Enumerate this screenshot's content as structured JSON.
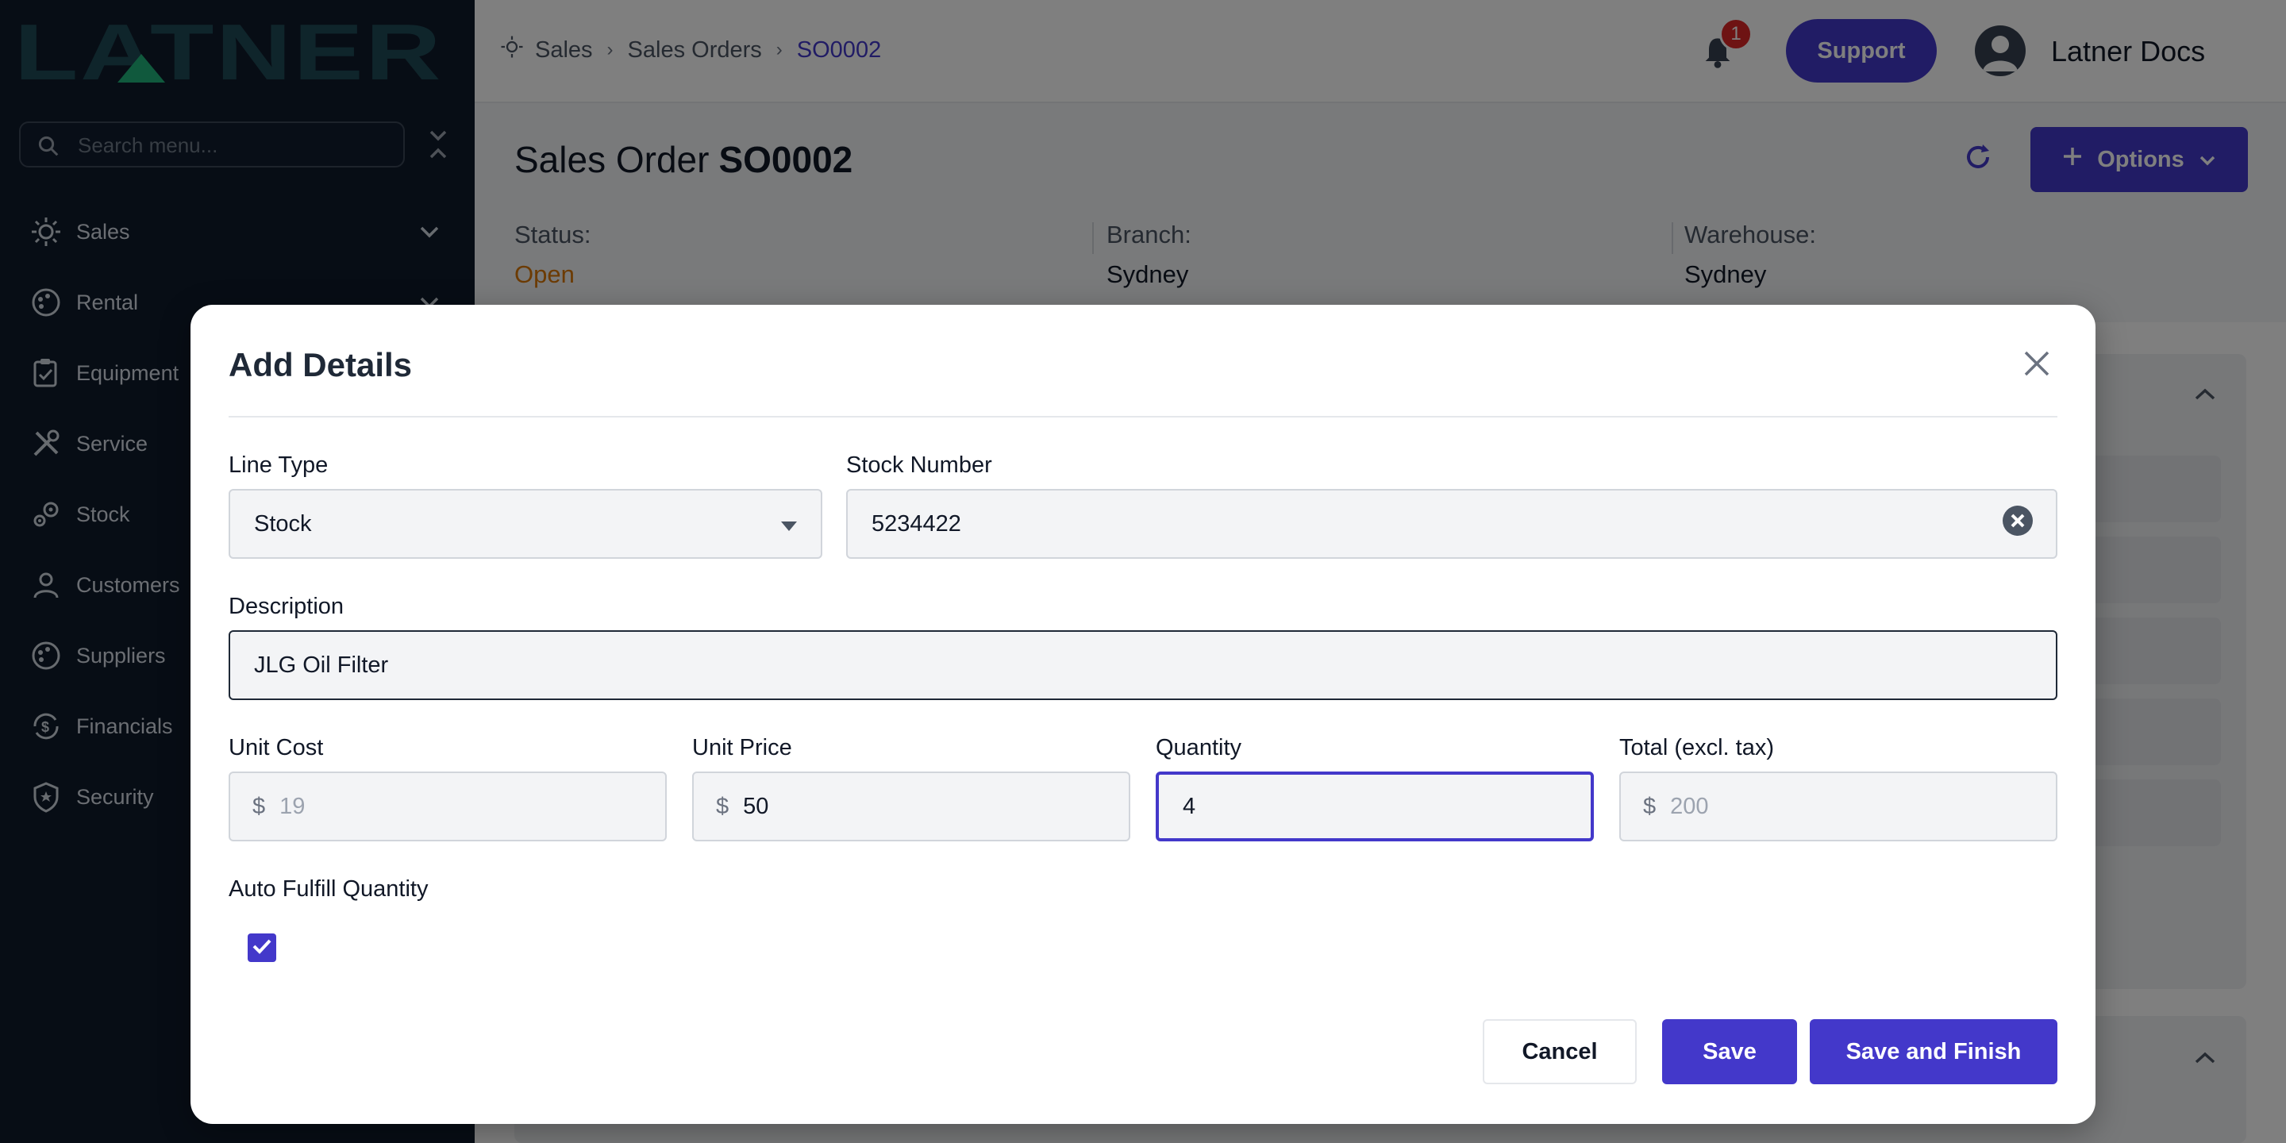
{
  "sidebar": {
    "logo_text": "LATNER",
    "search_placeholder": "Search menu...",
    "items": [
      {
        "label": "Sales",
        "icon": "sales-icon"
      },
      {
        "label": "Rental",
        "icon": "rental-icon"
      },
      {
        "label": "Equipment",
        "icon": "clipboard-icon"
      },
      {
        "label": "Service",
        "icon": "tools-icon"
      },
      {
        "label": "Stock",
        "icon": "gears-icon"
      },
      {
        "label": "Customers",
        "icon": "user-icon"
      },
      {
        "label": "Suppliers",
        "icon": "palette-icon"
      },
      {
        "label": "Financials",
        "icon": "dollar-cycle-icon"
      },
      {
        "label": "Security",
        "icon": "shield-icon"
      }
    ]
  },
  "header": {
    "breadcrumb": [
      "Sales",
      "Sales Orders",
      "SO0002"
    ],
    "notification_count": "1",
    "support_label": "Support",
    "user_name": "Latner Docs"
  },
  "order": {
    "title_prefix": "Sales Order",
    "title_id": "SO0002",
    "options_label": "Options",
    "status_label": "Status:",
    "status_value": "Open",
    "branch_label": "Branch:",
    "branch_value": "Sydney",
    "warehouse_label": "Warehouse:",
    "warehouse_value": "Sydney"
  },
  "modal": {
    "title": "Add Details",
    "line_type_label": "Line Type",
    "line_type_value": "Stock",
    "stock_number_label": "Stock Number",
    "stock_number_value": "5234422",
    "description_label": "Description",
    "description_value": "JLG Oil Filter",
    "unit_cost_label": "Unit Cost",
    "unit_cost_prefix": "$",
    "unit_cost_value": "19",
    "unit_price_label": "Unit Price",
    "unit_price_prefix": "$",
    "unit_price_value": "50",
    "quantity_label": "Quantity",
    "quantity_value": "4",
    "total_label": "Total (excl. tax)",
    "total_prefix": "$",
    "total_value": "200",
    "auto_fulfill_label": "Auto Fulfill Quantity",
    "auto_fulfill_checked": true,
    "cancel_label": "Cancel",
    "save_label": "Save",
    "save_finish_label": "Save and Finish"
  },
  "colors": {
    "accent": "#4338ca",
    "sidebar_bg": "#0f1b2b",
    "status_open": "#d97706",
    "badge": "#dc2626"
  }
}
